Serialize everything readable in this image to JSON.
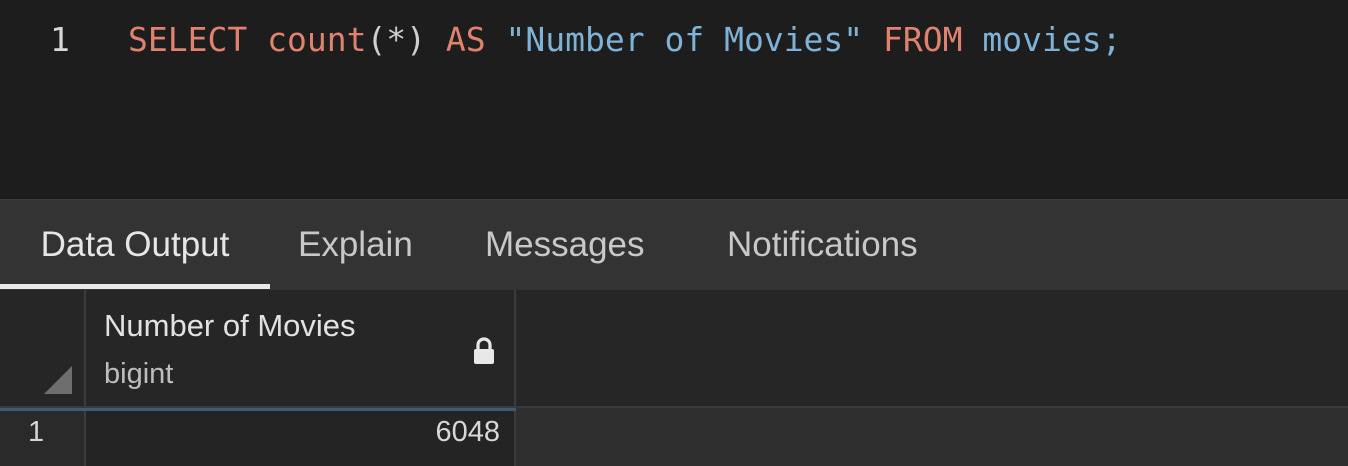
{
  "editor": {
    "line_number": "1",
    "tokens": {
      "select": "SELECT",
      "count": "count",
      "args": "(*)",
      "as": "AS",
      "alias": "\"Number of Movies\"",
      "from": "FROM",
      "table": "movies",
      "semicolon": ";"
    }
  },
  "tabs": [
    {
      "label": "Data Output",
      "active": true
    },
    {
      "label": "Explain",
      "active": false
    },
    {
      "label": "Messages",
      "active": false
    },
    {
      "label": "Notifications",
      "active": false
    }
  ],
  "result_grid": {
    "columns": [
      {
        "name": "Number of Movies",
        "type": "bigint",
        "icon": "lock-icon"
      }
    ],
    "rows": [
      {
        "row_number": "1",
        "values": [
          "6048"
        ]
      }
    ]
  },
  "colors": {
    "keyword": "#e0826d",
    "string": "#7fb2d7",
    "editor_bg": "#1d1d1d",
    "tabbar_bg": "#333333"
  }
}
